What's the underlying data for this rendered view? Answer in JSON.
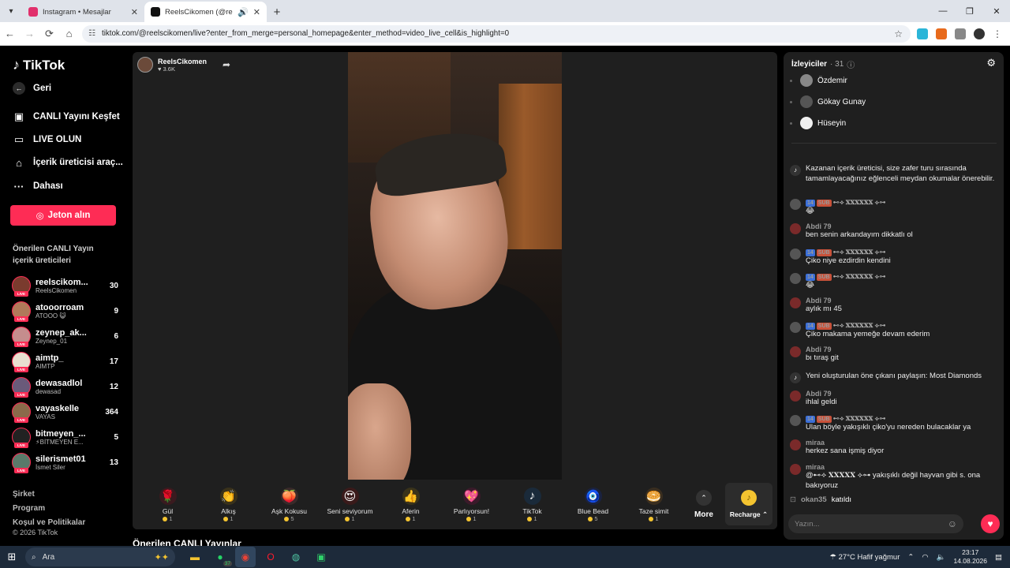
{
  "browser": {
    "tabs": [
      {
        "label": "Instagram • Mesajlar",
        "active": false,
        "color": "#e1306c"
      },
      {
        "label": "ReelsCikomen (@reelscikom",
        "active": true,
        "color": "#111111"
      }
    ],
    "url": "tiktok.com/@reelscikomen/live?enter_from_merge=personal_homepage&enter_method=video_live_cell&is_highlight=0"
  },
  "sidebar": {
    "logo": "TikTok",
    "back": "Geri",
    "nav": [
      "CANLI Yayını Keşfet",
      "LIVE OLUN",
      "İçerik üreticisi araç...",
      "Dahası"
    ],
    "jeton": "Jeton alın",
    "suggest_heading": "Önerilen CANLI Yayın içerik üreticileri",
    "creators": [
      {
        "name": "reelscikom...",
        "sub": "ReelsCikomen",
        "count": "30",
        "color": "#7a3b2e"
      },
      {
        "name": "atooorroam",
        "sub": "ATOOO 😺",
        "count": "9",
        "color": "#b07a5a"
      },
      {
        "name": "zeynep_ak...",
        "sub": "Zeynep_01",
        "count": "6",
        "color": "#c58d8d"
      },
      {
        "name": "aimtp_",
        "sub": "AIMTP",
        "count": "17",
        "color": "#e8e0d0"
      },
      {
        "name": "dewasadlol",
        "sub": "dewasad",
        "count": "12",
        "color": "#6a5a7a"
      },
      {
        "name": "vayaskelle",
        "sub": "VAYAS",
        "count": "364",
        "color": "#8a6a4a"
      },
      {
        "name": "bitmeyen_...",
        "sub": "⚡BİTMEYEN E...",
        "count": "5",
        "color": "#222222"
      },
      {
        "name": "silerismet01",
        "sub": "İsmet Siler",
        "count": "13",
        "color": "#5a7a6a"
      }
    ],
    "footer": [
      "Şirket",
      "Program",
      "Koşul ve Politikalar"
    ],
    "copyright": "© 2026 TikTok"
  },
  "stream": {
    "host_name": "ReelsCikomen",
    "host_likes": "3.6K"
  },
  "gifts": [
    {
      "name": "Gül",
      "price": "1",
      "icon": "🌹"
    },
    {
      "name": "Alkış",
      "price": "1",
      "icon": "👏"
    },
    {
      "name": "Aşk Kokusu",
      "price": "5",
      "icon": "🍑"
    },
    {
      "name": "Seni seviyorum",
      "price": "1",
      "icon": "😍"
    },
    {
      "name": "Aferin",
      "price": "1",
      "icon": "👍"
    },
    {
      "name": "Parlıyorsun!",
      "price": "1",
      "icon": "💖"
    },
    {
      "name": "TikTok",
      "price": "1",
      "icon": "♪"
    },
    {
      "name": "Blue Bead",
      "price": "5",
      "icon": "🧿"
    },
    {
      "name": "Taze simit",
      "price": "1",
      "icon": "🥯"
    }
  ],
  "more_label": "More",
  "recharge_label": "Recharge",
  "onerilen_title": "Önerilen CANLI Yayınlar",
  "chat": {
    "viewers_title": "İzleyiciler",
    "viewers_count": "· 31",
    "viewers": [
      {
        "name": "Özdemir",
        "color": "#888888"
      },
      {
        "name": "Gökay Gunay",
        "color": "#555555"
      },
      {
        "name": "Hüseyin",
        "color": "#f0f0f0"
      }
    ],
    "messages": [
      {
        "type": "system",
        "text": "Kazanan içerik üreticisi, size zafer turu sırasında tamamlayacağınız eğlenceli meydan okumalar önerebilir."
      },
      {
        "type": "sub",
        "lvl": "14",
        "sub": "SUB",
        "user": "⊷⟢ 𝐗𝐗𝐗𝐗𝐗𝐗 ⟣⊶",
        "text": "😂"
      },
      {
        "type": "user",
        "user": "Abdi 79",
        "text": "ben senin arkandayım dikkatlı ol"
      },
      {
        "type": "sub",
        "lvl": "14",
        "sub": "SUB",
        "user": "⊷⟢ 𝐗𝐗𝐗𝐗𝐗𝐗 ⟣⊶",
        "text": "Çiko niye ezdirdin kendini"
      },
      {
        "type": "sub",
        "lvl": "14",
        "sub": "SUB",
        "user": "⊷⟢ 𝐗𝐗𝐗𝐗𝐗𝐗 ⟣⊶",
        "text": "😂"
      },
      {
        "type": "user",
        "user": "Abdi 79",
        "text": "aylık mı 45"
      },
      {
        "type": "sub",
        "lvl": "14",
        "sub": "SUB",
        "user": "⊷⟢ 𝐗𝐗𝐗𝐗𝐗𝐗 ⟣⊶",
        "text": "Çiko makama yemeğe devam ederim"
      },
      {
        "type": "user",
        "user": "Abdi 79",
        "text": "bı tıraş git"
      },
      {
        "type": "system",
        "text": "Yeni oluşturulan öne çıkanı paylaşın: Most Diamonds"
      },
      {
        "type": "user",
        "user": "Abdi 79",
        "text": "ihlal geldi"
      },
      {
        "type": "sub",
        "lvl": "14",
        "sub": "SUB",
        "user": "⊷⟢ 𝐗𝐗𝐗𝐗𝐗𝐗 ⟣⊶",
        "text": "Ulan böyle yakışıklı çiko'yu nereden bulacaklar ya"
      },
      {
        "type": "user",
        "user": "miraa",
        "text": "herkez sana işmiş diyor"
      },
      {
        "type": "user",
        "user": "miraa",
        "text": "@⊷⟢ 𝐗𝐗𝐗𝐗𝐗 ⟣⊶ yakışıklı değil hayvan gibi s. ona bakıyoruz"
      }
    ],
    "joined_user": "okan35",
    "joined_text": "katıldı",
    "input_placeholder": "Yazın..."
  },
  "taskbar": {
    "search_placeholder": "Ara",
    "whatsapp_badge": "37",
    "weather": "27°C  Hafif yağmur",
    "time": "23:17",
    "date": "14.08.2026"
  }
}
